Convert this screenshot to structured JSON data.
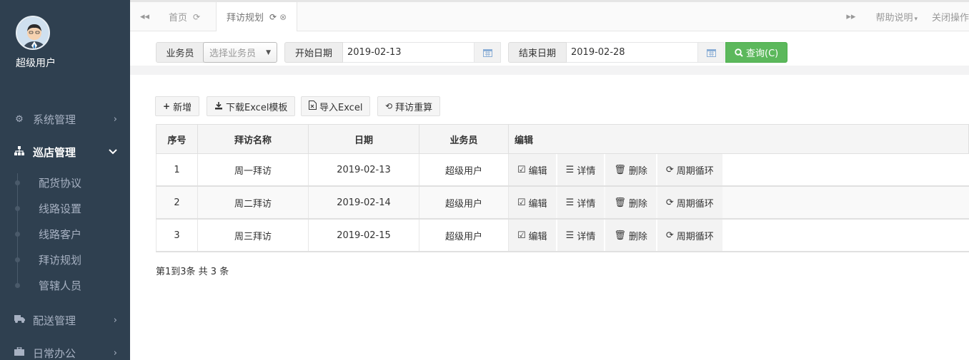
{
  "user": {
    "name": "超级用户"
  },
  "sidebar": {
    "menus": [
      {
        "label": "系统管理",
        "icon": "gears-icon"
      },
      {
        "label": "巡店管理",
        "icon": "sitemap-icon"
      },
      {
        "label": "配送管理",
        "icon": "truck-icon"
      },
      {
        "label": "日常办公",
        "icon": "briefcase-icon"
      }
    ],
    "submenu": [
      {
        "label": "配货协议"
      },
      {
        "label": "线路设置"
      },
      {
        "label": "线路客户"
      },
      {
        "label": "拜访规划"
      },
      {
        "label": "管辖人员"
      }
    ]
  },
  "tabs": {
    "home": "首页",
    "active": "拜访规划",
    "help": "帮助说明",
    "close_ops": "关闭操作"
  },
  "filters": {
    "salesman_label": "业务员",
    "salesman_placeholder": "选择业务员",
    "start_label": "开始日期",
    "start_value": "2019-02-13",
    "end_label": "结束日期",
    "end_value": "2019-02-28",
    "query_label": "查询(C)"
  },
  "toolbar": {
    "add": "新增",
    "download": "下载Excel模板",
    "import": "导入Excel",
    "recalc": "拜访重算"
  },
  "table": {
    "headers": {
      "index": "序号",
      "name": "拜访名称",
      "date": "日期",
      "salesman": "业务员",
      "edit": "编辑"
    },
    "rows": [
      {
        "index": "1",
        "name": "周一拜访",
        "date": "2019-02-13",
        "salesman": "超级用户"
      },
      {
        "index": "2",
        "name": "周二拜访",
        "date": "2019-02-14",
        "salesman": "超级用户"
      },
      {
        "index": "3",
        "name": "周三拜访",
        "date": "2019-02-15",
        "salesman": "超级用户"
      }
    ],
    "actions": {
      "edit": "编辑",
      "detail": "详情",
      "delete": "删除",
      "cycle": "周期循环"
    }
  },
  "pagination": {
    "info": "第1到3条 共 3 条"
  }
}
